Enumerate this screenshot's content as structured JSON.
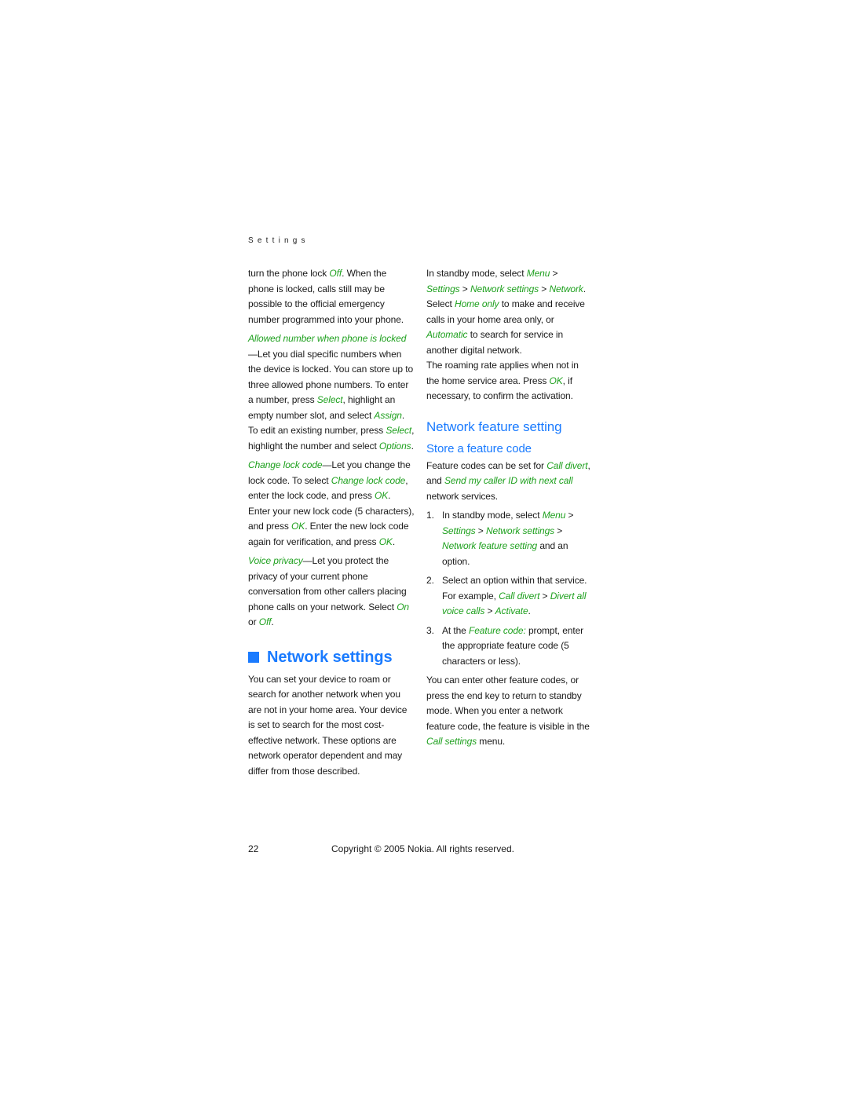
{
  "running_head": "Settings",
  "left_column": {
    "p1": [
      "turn the phone lock ",
      "Off",
      ". When the phone is locked, calls still may be possible to the official emergency number programmed into your phone."
    ],
    "allowed": {
      "term": "Allowed number when phone is locked",
      "t1": "—Let you dial specific numbers when the device is locked. You can store up to three allowed phone numbers. To enter a number, press ",
      "k1": "Select",
      "t2": ", highlight an empty number slot, and select ",
      "k2": "Assign",
      "t3": ". To edit an existing number, press ",
      "k3": "Select",
      "t4": ", highlight the number and select ",
      "k4": "Options",
      "t5": "."
    },
    "change_lock": {
      "term": "Change lock code",
      "t1": "—Let you change the lock code. To select ",
      "k1": "Change lock code",
      "t2": ", enter the lock code, and press ",
      "k2": "OK",
      "t3": ". Enter your new lock code (5 characters), and press ",
      "k3": "OK",
      "t4": ". Enter the new lock code again for verification, and press ",
      "k4": "OK",
      "t5": "."
    },
    "voice_privacy": {
      "term": "Voice privacy",
      "t1": "—Let you protect the privacy of your current phone conversation from other callers placing phone calls on your network. Select ",
      "k1": "On",
      "t2": " or ",
      "k2": "Off",
      "t3": "."
    },
    "network_settings": {
      "heading": "Network settings",
      "body": "You can set your device to roam or search for another network when you are not in your home area. Your device is set to search for the most cost-effective network. These options are network operator dependent and may differ from those described."
    }
  },
  "right_column": {
    "standby": {
      "t1": "In standby mode, select ",
      "k1": "Menu",
      "s1": " > ",
      "k2": "Settings",
      "s2": " > ",
      "k3": "Network settings",
      "s3": " > ",
      "k4": "Network",
      "t2": ". Select ",
      "k5": "Home only",
      "t3": " to make and receive calls in your home area only, or ",
      "k6": "Automatic",
      "t4": " to search for service in another digital network."
    },
    "roaming": {
      "t1": "The roaming rate applies when not in the home service area. Press ",
      "k1": "OK",
      "t2": ", if necessary, to confirm the activation."
    },
    "feature_heading": "Network feature setting",
    "store_heading": "Store a feature code",
    "store_intro": {
      "t1": "Feature codes can be set for ",
      "k1": "Call divert",
      "t2": ", and ",
      "k2": "Send my caller ID with next call",
      "t3": " network services."
    },
    "steps": [
      {
        "num": "1.",
        "t1": "In standby mode, select ",
        "k1": "Menu",
        "s1": " > ",
        "k2": "Settings",
        "s2": " > ",
        "k3": "Network settings",
        "s3": " > ",
        "k4": "Network feature setting",
        "t2": " and an option."
      },
      {
        "num": "2.",
        "t1": "Select an option within that service. For example, ",
        "k1": "Call divert",
        "s1": " > ",
        "k2": "Divert all voice calls",
        "s2": " > ",
        "k3": "Activate",
        "t2": "."
      },
      {
        "num": "3.",
        "t1": " At the ",
        "k1": "Feature code:",
        "t2": " prompt, enter the appropriate feature code (5 characters or less)."
      }
    ],
    "closing": {
      "t1": "You can enter other feature codes, or press the end key to return to standby mode. When you enter a network feature code, the feature is visible in the ",
      "k1": "Call settings",
      "t2": " menu."
    }
  },
  "footer": {
    "page_number": "22",
    "copyright": "Copyright © 2005 Nokia. All rights reserved."
  },
  "colors": {
    "heading_blue": "#1a7bff",
    "keyword_green": "#1ea01e",
    "text": "#1a1a1a"
  }
}
